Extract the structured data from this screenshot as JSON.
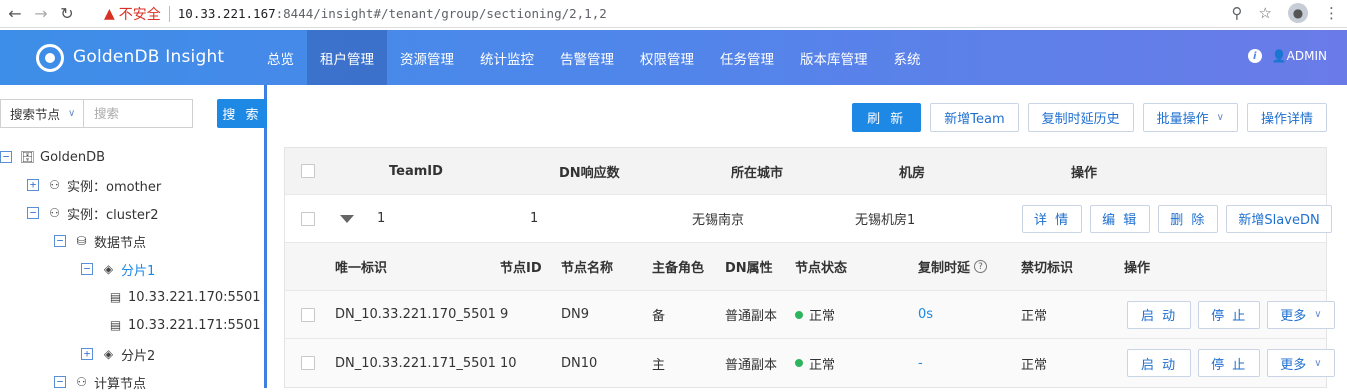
{
  "browser": {
    "back_icon": "arrow-left-icon",
    "warning_label": "不安全",
    "url_host": "10.33.221.167",
    "url_rest": ":8444/insight#/tenant/group/sectioning/2,1,2"
  },
  "header": {
    "brand": "GoldenDB Insight",
    "nav": [
      "总览",
      "租户管理",
      "资源管理",
      "统计监控",
      "告警管理",
      "权限管理",
      "任务管理",
      "版本库管理",
      "系统"
    ],
    "active_nav": "租户管理",
    "user": "ADMIN"
  },
  "sidebar": {
    "search_select": "搜索节点",
    "search_placeholder": "搜索",
    "search_button": "搜 索",
    "tree": [
      {
        "label": "GoldenDB",
        "toggle": "⊟",
        "icon": "database-icon"
      },
      {
        "label": "实例：omother",
        "toggle": "⊞",
        "icon": "cluster-icon"
      },
      {
        "label": "实例：cluster2",
        "toggle": "⊟",
        "icon": "cluster-icon"
      },
      {
        "label": "数据节点",
        "toggle": "⊟",
        "icon": "datanode-icon"
      },
      {
        "label": "分片1",
        "toggle": "⊟",
        "icon": "layers-icon"
      },
      {
        "label": "10.33.221.170:5501",
        "toggle": "",
        "icon": "server-icon"
      },
      {
        "label": "10.33.221.171:5501",
        "toggle": "",
        "icon": "server-icon"
      },
      {
        "label": "分片2",
        "toggle": "⊞",
        "icon": "layers-icon"
      },
      {
        "label": "计算节点",
        "toggle": "⊟",
        "icon": "compute-icon"
      }
    ]
  },
  "toolbar": {
    "refresh": "刷 新",
    "add_team": "新增Team",
    "replication_history": "复制时延历史",
    "batch_ops": "批量操作",
    "op_details": "操作详情"
  },
  "team_table": {
    "headers": [
      "TeamID",
      "DN响应数",
      "所在城市",
      "机房",
      "操作"
    ],
    "row": {
      "team_id": "1",
      "dn_count": "1",
      "city": "无锡南京",
      "room": "无锡机房1",
      "actions": [
        "详 情",
        "编 辑",
        "删 除",
        "新增SlaveDN"
      ]
    }
  },
  "dn_table": {
    "headers": [
      "唯一标识",
      "节点ID",
      "节点名称",
      "主备角色",
      "DN属性",
      "节点状态",
      "复制时延",
      "禁切标识",
      "操作"
    ],
    "rows": [
      {
        "uid": "DN_10.33.221.170_5501",
        "node_id": "9",
        "name": "DN9",
        "role": "备",
        "attr": "普通副本",
        "status": "正常",
        "delay": "0s",
        "ban": "正常"
      },
      {
        "uid": "DN_10.33.221.171_5501",
        "node_id": "10",
        "name": "DN10",
        "role": "主",
        "attr": "普通副本",
        "status": "正常",
        "delay": "-",
        "ban": "正常"
      }
    ],
    "actions": [
      "启 动",
      "停 止",
      "更多"
    ]
  },
  "colors": {
    "primary": "#1e88e5",
    "status_ok": "#2db55d"
  }
}
